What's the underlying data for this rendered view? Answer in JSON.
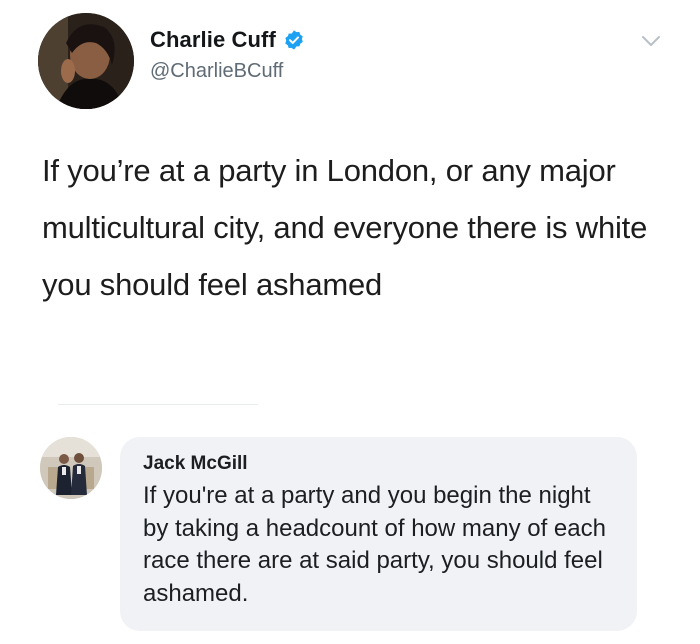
{
  "tweet": {
    "author": {
      "display_name": "Charlie Cuff",
      "handle": "@CharlieBCuff",
      "verified": true,
      "avatar_icon": "profile-photo",
      "verified_icon": "verified-badge-icon",
      "verified_color": "#1da1f2"
    },
    "menu_icon": "chevron-down-icon",
    "text": "If you’re at a party in London, or any major multicultural city, and everyone there is white you should feel ashamed"
  },
  "reply": {
    "author": "Jack McGill",
    "avatar_icon": "profile-photo",
    "text": "If you're at a party and you begin the night by taking a headcount of how many of each race there are at said party, you should feel ashamed.",
    "bubble_color": "#f0f2f5"
  }
}
